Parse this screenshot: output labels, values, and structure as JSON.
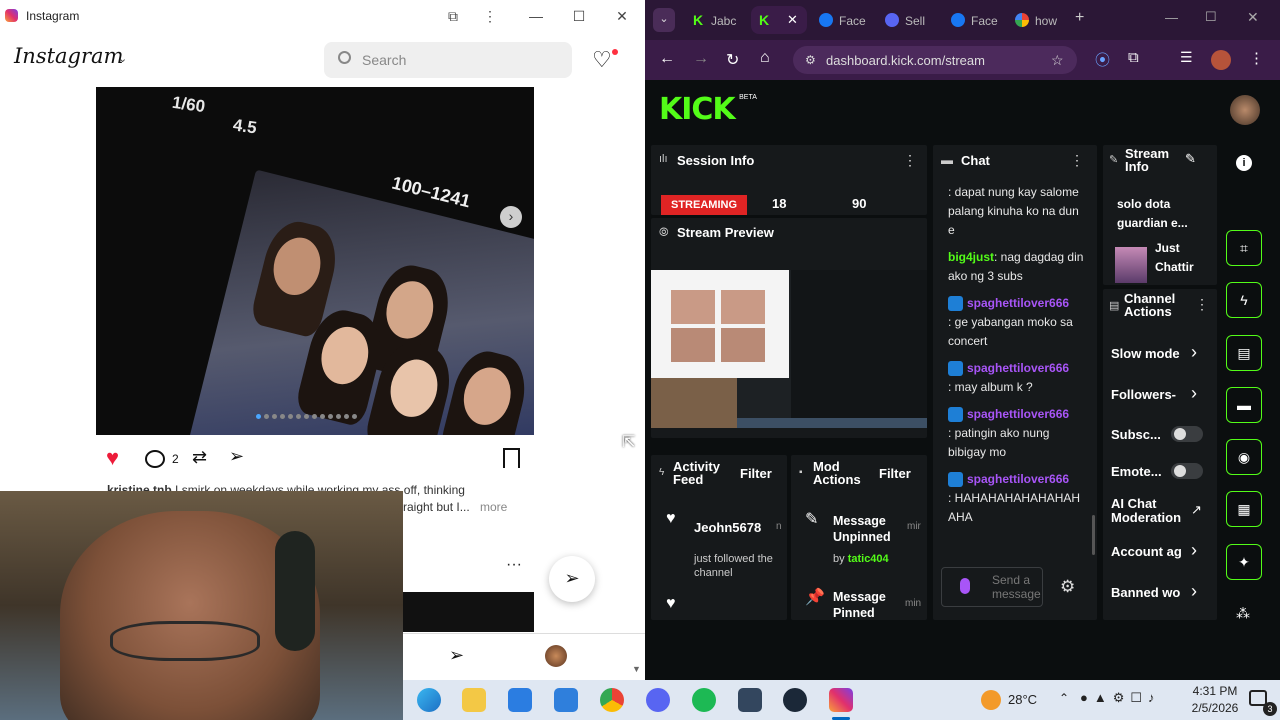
{
  "instagram": {
    "window_title": "Instagram",
    "logo": "Instagram",
    "search_placeholder": "Search",
    "photo_caption_1": "1/60",
    "photo_caption_2": "4.5",
    "photo_caption_3": "100–1241",
    "comments_count": "2",
    "post_author": "kristine.tnb",
    "post_caption": "I smirk on weekdays while working my ass off, thinking",
    "post_caption_2": "raight but I...",
    "more": "more"
  },
  "browser": {
    "tabs": [
      "Jabc",
      "",
      "Face",
      "Sell",
      "Face",
      "how"
    ],
    "url": "dashboard.kick.com/stream"
  },
  "kick": {
    "logo": "KICK",
    "logo_beta": "BETA",
    "session_info": {
      "title": "Session Info",
      "status": "STREAMING",
      "viewers": "18",
      "followers": "90"
    },
    "stream_preview": {
      "title": "Stream Preview"
    },
    "activity_feed": {
      "title": "Activity Feed",
      "filter": "Filter",
      "user": "Jeohn5678",
      "user_suffix": "n",
      "event": "just followed the channel"
    },
    "mod_actions": {
      "title": "Mod Actions",
      "filter": "Filter",
      "items": [
        {
          "label": "Message Unpinned",
          "by_prefix": "by",
          "by_user": "tatic404",
          "suffix": "mir"
        },
        {
          "label": "Message Pinned",
          "suffix": "min"
        }
      ]
    },
    "chat": {
      "title": "Chat",
      "messages": [
        {
          "user": "",
          "text": ": dapat nung kay salome palang kinuha ko na dun e"
        },
        {
          "user": "big4just",
          "text": ": nag dagdag din ako ng 3 subs"
        },
        {
          "user": "spaghettilover666",
          "text": ": ge yabangan moko sa concert"
        },
        {
          "user": "spaghettilover666",
          "text": ": may album k ?"
        },
        {
          "user": "spaghettilover666",
          "text": ": patingin ako nung bibigay mo"
        },
        {
          "user": "spaghettilover666",
          "text": ": HAHAHAHAHAHAHAHAHA"
        }
      ],
      "input_placeholder": "Send a message"
    },
    "stream_info": {
      "title": "Stream Info",
      "stream_title": "solo dota guardian e...",
      "category": "Just Chattir"
    },
    "channel_actions": {
      "title": "Channel Actions",
      "items": [
        "Slow mode",
        "Followers-",
        "Subsc...",
        "Emote...",
        "AI Chat Moderation",
        "Account ag",
        "Banned wo"
      ]
    }
  },
  "taskbar": {
    "weather": "28°C",
    "time": "4:31 PM",
    "date": "2/5/2026",
    "notif": "3"
  }
}
